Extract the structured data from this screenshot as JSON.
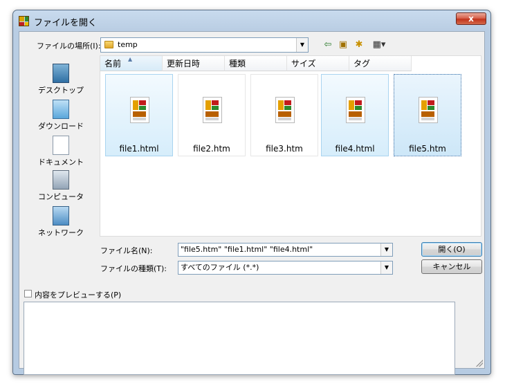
{
  "window": {
    "title": "ファイルを開く",
    "close_label": "x"
  },
  "look_in": {
    "label": "ファイルの場所(I):",
    "value": "temp"
  },
  "toolbar": {
    "back_icon": "⇦",
    "up_icon": "▣",
    "new_folder_icon": "✱",
    "views_icon": "▦▾"
  },
  "columns": [
    "名前",
    "更新日時",
    "種類",
    "サイズ",
    "タグ"
  ],
  "files": [
    {
      "name": "file1.html",
      "state": "selected"
    },
    {
      "name": "file2.htm",
      "state": "normal"
    },
    {
      "name": "file3.htm",
      "state": "normal"
    },
    {
      "name": "file4.html",
      "state": "selected"
    },
    {
      "name": "file5.htm",
      "state": "focused"
    }
  ],
  "places": [
    {
      "label": "デスクトップ",
      "icon": "desktop-icon"
    },
    {
      "label": "ダウンロード",
      "icon": "download-icon"
    },
    {
      "label": "ドキュメント",
      "icon": "documents-icon"
    },
    {
      "label": "コンピュータ",
      "icon": "computer-icon"
    },
    {
      "label": "ネットワーク",
      "icon": "network-icon"
    }
  ],
  "filename": {
    "label": "ファイル名(N):",
    "value": "\"file5.htm\" \"file1.html\" \"file4.html\""
  },
  "filetype": {
    "label": "ファイルの種類(T):",
    "value": "すべてのファイル (*.*)"
  },
  "buttons": {
    "open": "開く(O)",
    "cancel": "キャンセル"
  },
  "preview": {
    "label": "内容をプレビューする(P)",
    "checked": false
  },
  "colors": {
    "selection": "#d6edfb",
    "selection_border": "#a9d4f0",
    "title_gradient": "#c9dbee"
  }
}
